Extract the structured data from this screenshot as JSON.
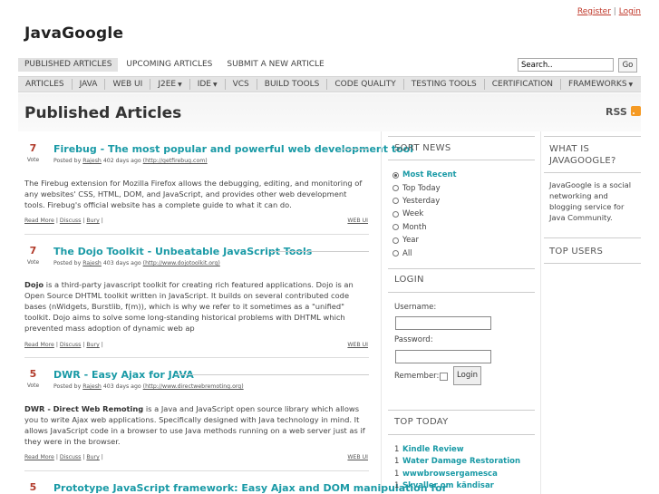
{
  "auth": {
    "register": "Register",
    "sep": "|",
    "login": "Login"
  },
  "site": {
    "title": "JavaGoogle"
  },
  "subnav": [
    {
      "label": "PUBLISHED ARTICLES",
      "active": true
    },
    {
      "label": "UPCOMING ARTICLES",
      "active": false
    },
    {
      "label": "SUBMIT A NEW ARTICLE",
      "active": false
    }
  ],
  "search": {
    "value": "Search..",
    "button": "Go"
  },
  "categories": [
    {
      "label": "ARTICLES",
      "dropdown": false
    },
    {
      "label": "JAVA",
      "dropdown": false
    },
    {
      "label": "WEB UI",
      "dropdown": false
    },
    {
      "label": "J2EE",
      "dropdown": true
    },
    {
      "label": "IDE",
      "dropdown": true
    },
    {
      "label": "VCS",
      "dropdown": false
    },
    {
      "label": "BUILD TOOLS",
      "dropdown": false
    },
    {
      "label": "CODE QUALITY",
      "dropdown": false
    },
    {
      "label": "TESTING TOOLS",
      "dropdown": false
    },
    {
      "label": "CERTIFICATION",
      "dropdown": false
    },
    {
      "label": "FRAMEWORKS",
      "dropdown": true
    }
  ],
  "page": {
    "title": "Published Articles",
    "rss": "RSS"
  },
  "articles": [
    {
      "votes": "7",
      "vote_label": "Vote",
      "title": "Firebug - The most popular and powerful web development tool",
      "meta_prefix": "Posted by",
      "author": "Rajesh",
      "meta_age": "402 days ago",
      "url": "(http://getfirebug.com)",
      "body_lead": "",
      "body": "The Firebug extension for Mozilla Firefox allows the debugging, editing, and monitoring of any websites' CSS, HTML, DOM, and JavaScript, and provides other web development tools. Firebug's official website has a complete guide to what it can do.",
      "read_more": "Read More",
      "discuss": "Discuss",
      "bury": "Bury",
      "category": "WEB UI"
    },
    {
      "votes": "7",
      "vote_label": "Vote",
      "title": "The Dojo Toolkit - Unbeatable JavaScript Tools",
      "meta_prefix": "Posted by",
      "author": "Rajesh",
      "meta_age": "403 days ago",
      "url": "(http://www.dojotoolkit.org)",
      "body_lead": "Dojo",
      "body": " is a third-party javascript toolkit for creating rich featured applications. Dojo is an Open Source DHTML toolkit written in JavaScript. It builds on several contributed code bases (nWidgets, Burstlib, f(m)), which is why we refer to it sometimes as a \"unified\" toolkit. Dojo aims to solve some long-standing historical problems with DHTML which prevented mass adoption of dynamic web ap",
      "read_more": "Read More",
      "discuss": "Discuss",
      "bury": "Bury",
      "category": "WEB UI"
    },
    {
      "votes": "5",
      "vote_label": "Vote",
      "title": "DWR - Easy Ajax for JAVA",
      "meta_prefix": "Posted by",
      "author": "Rajesh",
      "meta_age": "403 days ago",
      "url": "(http://www.directwebremoting.org)",
      "body_lead": "DWR - Direct Web Remoting",
      "body": " is a Java and JavaScript open source library which allows you to write Ajax web applications. Specifically designed with Java technology in mind. It allows JavaScript code in a browser to use Java methods running on a web server just as if they were in the browser.",
      "read_more": "Read More",
      "discuss": "Discuss",
      "bury": "Bury",
      "category": "WEB UI"
    },
    {
      "votes": "5",
      "vote_label": "Vote",
      "title": "Prototype JavaScript framework: Easy Ajax and DOM manipulation for",
      "meta_prefix": "",
      "author": "",
      "meta_age": "",
      "url": "",
      "body_lead": "",
      "body": "",
      "read_more": "",
      "discuss": "",
      "bury": "",
      "category": ""
    }
  ],
  "sort_news": {
    "heading": "SORT NEWS",
    "options": [
      {
        "label": "Most Recent",
        "selected": true
      },
      {
        "label": "Top Today",
        "selected": false
      },
      {
        "label": "Yesterday",
        "selected": false
      },
      {
        "label": "Week",
        "selected": false
      },
      {
        "label": "Month",
        "selected": false
      },
      {
        "label": "Year",
        "selected": false
      },
      {
        "label": "All",
        "selected": false
      }
    ]
  },
  "login": {
    "heading": "LOGIN",
    "username_label": "Username:",
    "password_label": "Password:",
    "remember_label": "Remember:",
    "button": "Login"
  },
  "top_today": {
    "heading": "TOP TODAY",
    "items": [
      {
        "n": "1",
        "title": "Kindle Review"
      },
      {
        "n": "1",
        "title": "Water Damage Restoration"
      },
      {
        "n": "1",
        "title": "wwwbrowsergamesca"
      },
      {
        "n": "1",
        "title": "Skvaller om kändisar"
      }
    ]
  },
  "about": {
    "heading": "WHAT IS JAVAGOOGLE?",
    "body": "JavaGoogle is a social networking and blogging service for Java Community."
  },
  "top_users": {
    "heading": "TOP USERS"
  }
}
